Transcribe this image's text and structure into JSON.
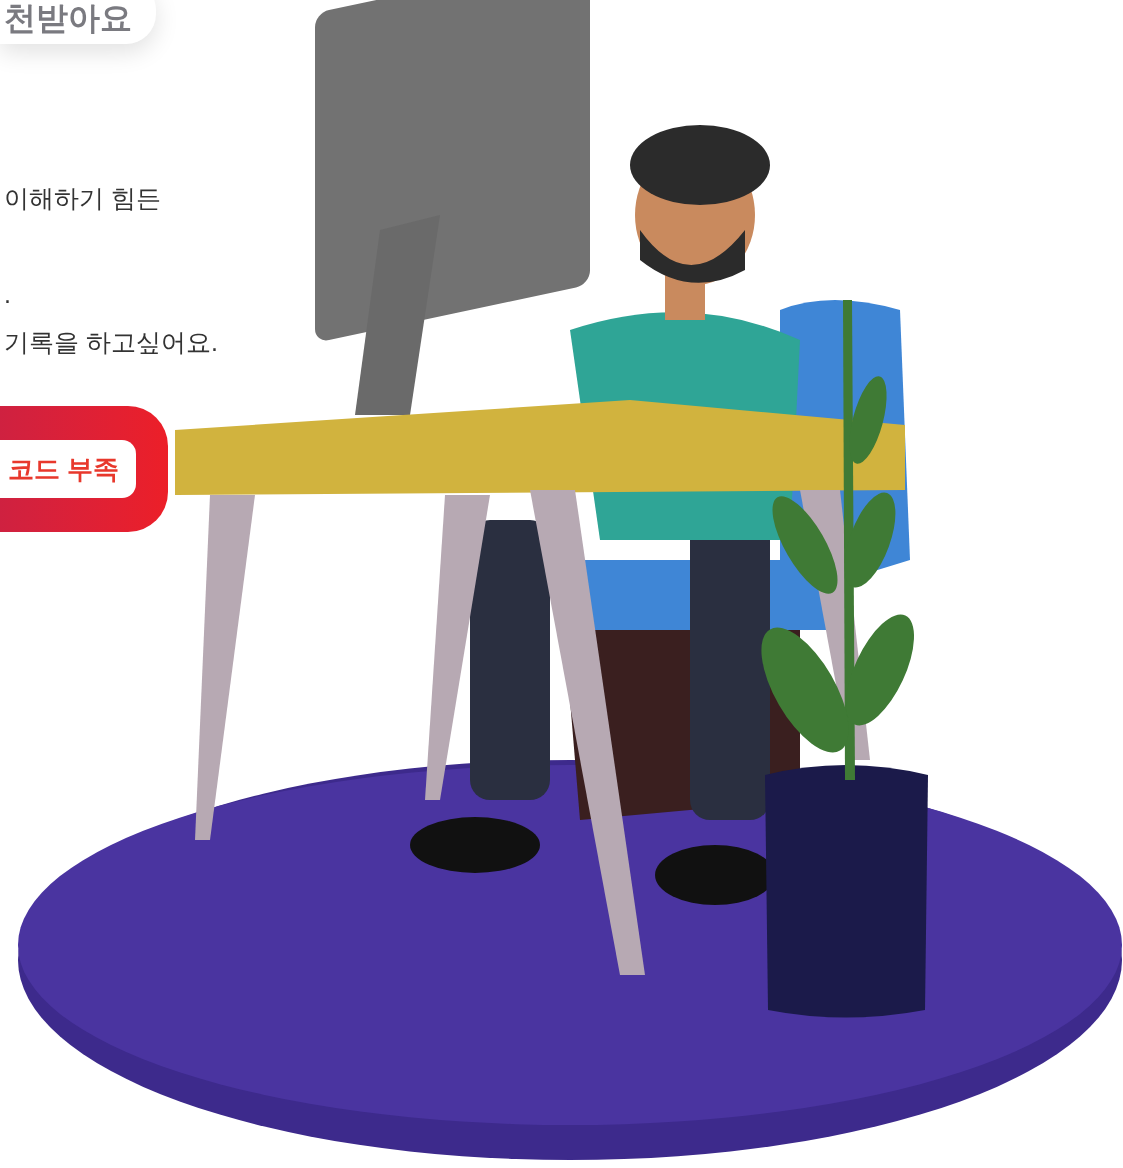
{
  "badge": {
    "text": "천받아요"
  },
  "description": {
    "lines": [
      "이해하기 힘든",
      ".",
      "기록을 하고싶어요."
    ]
  },
  "button": {
    "label": "코드 부족"
  }
}
